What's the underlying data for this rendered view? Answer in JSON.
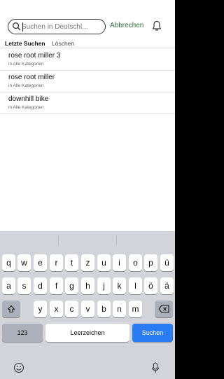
{
  "search": {
    "placeholder": "Suchen in Deutschl...",
    "cancel_label": "Abbrechen"
  },
  "tabs": {
    "recent_label": "Letzte Suchen",
    "clear_label": "Löschen"
  },
  "recent": [
    {
      "title": "rose root miller 3",
      "subtitle": "in Alle Kategorien"
    },
    {
      "title": "rose root miller",
      "subtitle": "in Alle Kategorien"
    },
    {
      "title": "downhill bike",
      "subtitle": "in Alle Kategorien"
    }
  ],
  "keyboard": {
    "row1": [
      "q",
      "w",
      "e",
      "r",
      "t",
      "z",
      "u",
      "i",
      "o",
      "p",
      "ü"
    ],
    "row2": [
      "a",
      "s",
      "d",
      "f",
      "g",
      "h",
      "j",
      "k",
      "l",
      "ö",
      "ä"
    ],
    "row3": [
      "y",
      "x",
      "c",
      "v",
      "b",
      "n",
      "m"
    ],
    "numbers_label": "123",
    "space_label": "Leerzeichen",
    "search_label": "Suchen"
  },
  "colors": {
    "accent_green": "#2f6b3a",
    "keyboard_blue": "#2b7cf2"
  },
  "icons": {
    "search": "search-icon",
    "notifications": "bell-icon",
    "shift": "shift-icon",
    "delete": "backspace-icon",
    "emoji": "emoji-icon",
    "dictation": "mic-icon"
  }
}
